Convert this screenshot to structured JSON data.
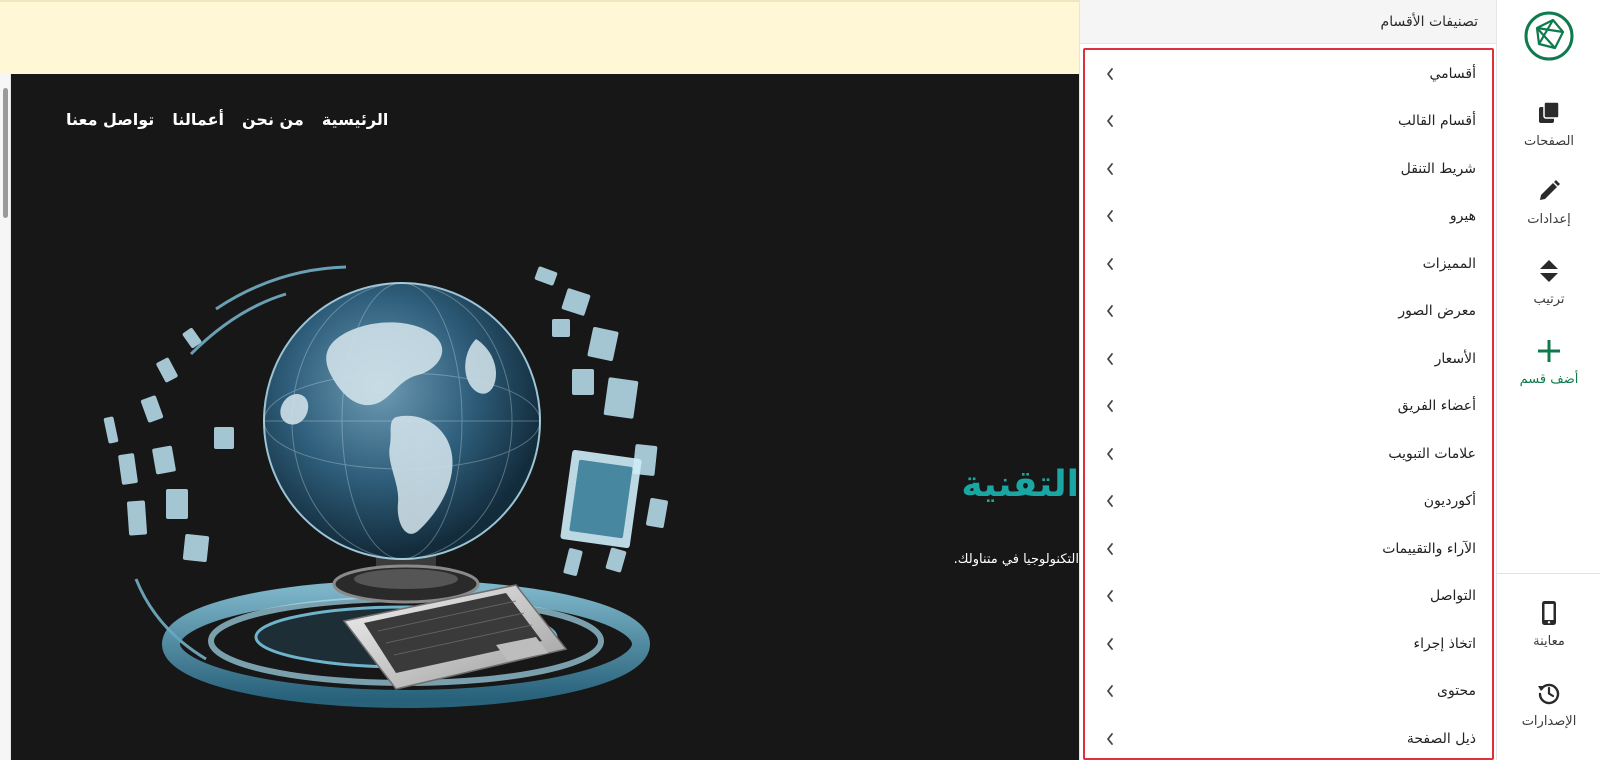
{
  "app": {
    "accent_color": "#0f7a4d",
    "highlight_color": "#e0303c"
  },
  "rail": {
    "logo_icon": "globe-logo-icon",
    "items": [
      {
        "label": "الصفحات",
        "icon": "pages-icon"
      },
      {
        "label": "إعدادات",
        "icon": "pencil-icon"
      },
      {
        "label": "ترتيب",
        "icon": "sort-icon"
      },
      {
        "label": "أضف قسم",
        "icon": "plus-icon"
      }
    ],
    "bottom_items": [
      {
        "label": "معاينة",
        "icon": "mobile-preview-icon"
      },
      {
        "label": "الإصدارات",
        "icon": "history-icon"
      }
    ]
  },
  "panel": {
    "title": "تصنيفات الأقسام",
    "sections": [
      "أقسامي",
      "أقسام القالب",
      "شريط التنقل",
      "هيرو",
      "المميزات",
      "معرض الصور",
      "الأسعار",
      "أعضاء الفريق",
      "علامات التبويب",
      "أكورديون",
      "الآراء والتقييمات",
      "التواصل",
      "اتخاذ إجراء",
      "محتوى",
      "ذيل الصفحة"
    ]
  },
  "site": {
    "nav": [
      "الرئيسية",
      "من نحن",
      "أعمالنا",
      "تواصل معنا"
    ],
    "hero_title": "التقنية",
    "hero_subtitle": "التكنولوجيا في متناولك."
  }
}
